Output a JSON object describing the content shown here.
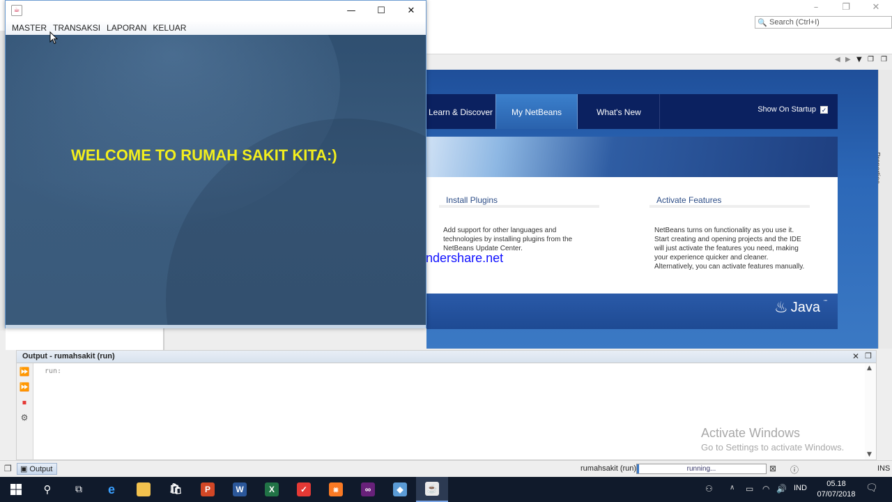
{
  "ide": {
    "search_placeholder": "Search (Ctrl+I)",
    "properties_label": "Properties"
  },
  "start_page": {
    "tabs": [
      {
        "label": "Learn & Discover"
      },
      {
        "label": "My NetBeans"
      },
      {
        "label": "What's New"
      }
    ],
    "show_on_startup": "Show On Startup",
    "install_plugins": {
      "title": "Install Plugins",
      "text": "Add support for other languages and technologies by installing plugins from the NetBeans Update Center."
    },
    "activate_features": {
      "title": "Activate Features",
      "text": "NetBeans turns on functionality as you use it. Start creating and opening projects and the IDE will just activate the features you need, making your experience quicker and cleaner. Alternatively, you can activate features manually."
    },
    "java_logo": "Java"
  },
  "watermark": "www.thundershare.net",
  "app": {
    "menu": [
      "MASTER",
      "TRANSAKSI",
      "LAPORAN",
      "KELUAR"
    ],
    "welcome": "WELCOME TO RUMAH SAKIT KITA:)"
  },
  "output": {
    "title": "Output - rumahsakit (run)",
    "text": "run:"
  },
  "activate_windows": {
    "line1": "Activate Windows",
    "line2": "Go to Settings to activate Windows."
  },
  "statusbar": {
    "output_button": "Output",
    "project": "rumahsakit (run)",
    "progress_text": "running...",
    "ins": "INS"
  },
  "taskbar": {
    "language": "IND",
    "time": "05.18",
    "date": "07/07/2018"
  }
}
